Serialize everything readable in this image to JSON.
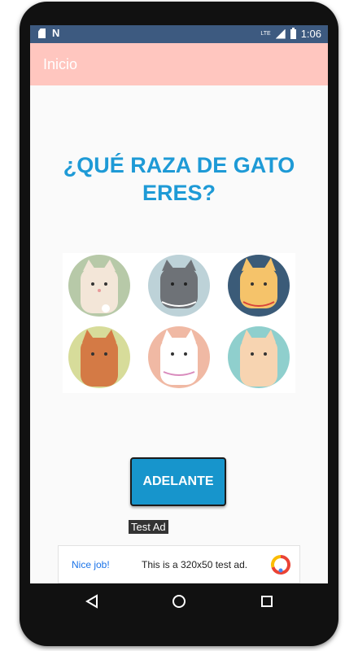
{
  "status_bar": {
    "time": "1:06",
    "network": "LTE",
    "icons": [
      "sd-card-icon",
      "n-notification-icon",
      "lte-icon",
      "signal-icon",
      "battery-charging-icon"
    ]
  },
  "app_bar": {
    "title": "Inicio",
    "color": "#ffc6bf"
  },
  "main": {
    "question": "¿QUÉ RAZA DE GATO ERES?",
    "question_color": "#1e9ad6",
    "image_icon": "cats-illustration",
    "next_button": "ADELANTE",
    "button_color": "#1795cc"
  },
  "ad": {
    "tag": "Test Ad",
    "nice_job": "Nice job!",
    "text": "This is a 320x50 test ad.",
    "logo_icon": "admob-logo-icon"
  },
  "nav_bar": {
    "icons": [
      "back-icon",
      "home-icon",
      "recents-icon"
    ]
  }
}
